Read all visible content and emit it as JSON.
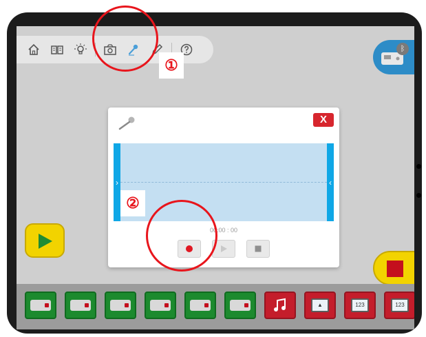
{
  "toolbar": {
    "icons": [
      "home-icon",
      "book-icon",
      "lightbulb-icon",
      "camera-icon",
      "microphone-icon",
      "pencil-icon",
      "question-icon"
    ]
  },
  "dialog": {
    "close_label": "X",
    "time": "00:00 : 00"
  },
  "palette": {
    "colors": {
      "action": "#1c8a2e",
      "sound_display": "#c41d2b",
      "start": "#f2d300",
      "accent": "#e8151c",
      "hub": "#2d8cc7"
    },
    "blocks": [
      {
        "kind": "motor-on-for-time",
        "color": "green"
      },
      {
        "kind": "motor-timer",
        "color": "green"
      },
      {
        "kind": "motor-off",
        "color": "green"
      },
      {
        "kind": "motor-counterclockwise",
        "color": "green"
      },
      {
        "kind": "motor-clockwise",
        "color": "green"
      },
      {
        "kind": "hub-light",
        "color": "green"
      },
      {
        "kind": "play-sound",
        "color": "red"
      },
      {
        "kind": "display-image",
        "color": "red"
      },
      {
        "kind": "display-number",
        "color": "red"
      },
      {
        "kind": "add-to-display",
        "color": "red"
      }
    ],
    "display_text": "123"
  },
  "annotations": {
    "label_1": "①",
    "label_2": "②"
  }
}
